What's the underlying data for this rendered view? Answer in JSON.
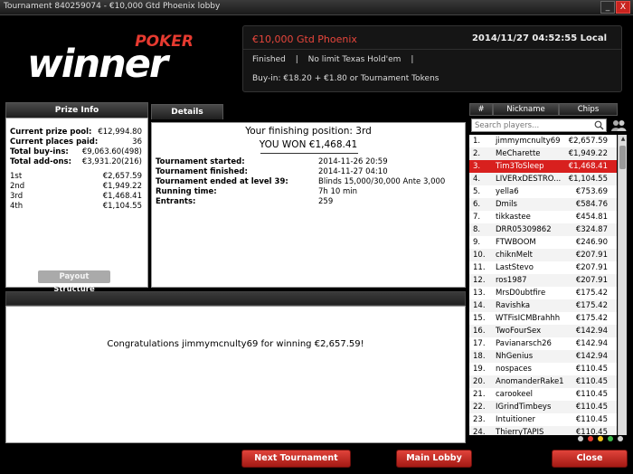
{
  "window": {
    "title": "Tournament 840259074 - €10,000 Gtd Phoenix lobby",
    "minimize_label": "_",
    "close_label": "X"
  },
  "logo": {
    "brand_top": "POKER",
    "brand_main": "winner"
  },
  "header": {
    "tournament_name": "€10,000 Gtd Phoenix",
    "datetime": "2014/11/27 04:52:55 Local",
    "status": "Finished",
    "game": "No limit Texas Hold'em",
    "buyin": "Buy-in: €18.20 + €1.80 or Tournament Tokens"
  },
  "tabs": {
    "prize_info": "Prize Info",
    "details": "Details"
  },
  "prize_info": {
    "current_prize_pool_label": "Current prize pool:",
    "current_prize_pool": "€12,994.80",
    "current_places_paid_label": "Current places paid:",
    "current_places_paid": "36",
    "total_buyins_label": "Total buy-ins:",
    "total_buyins": "€9,063.60(498)",
    "total_addons_label": "Total add-ons:",
    "total_addons": "€3,931.20(216)",
    "places": [
      {
        "place": "1st",
        "amount": "€2,657.59"
      },
      {
        "place": "2nd",
        "amount": "€1,949.22"
      },
      {
        "place": "3rd",
        "amount": "€1,468.41"
      },
      {
        "place": "4th",
        "amount": "€1,104.55"
      }
    ],
    "payout_button": "Payout Structure"
  },
  "details": {
    "finishing_position": "Your finishing position: 3rd",
    "you_won": "YOU WON €1,468.41",
    "rows": [
      {
        "label": "Tournament started:",
        "value": "2014-11-26 20:59"
      },
      {
        "label": "Tournament finished:",
        "value": "2014-11-27 04:10"
      },
      {
        "label": "Tournament ended at level 39:",
        "value": "Blinds 15,000/30,000 Ante 3,000"
      },
      {
        "label": "Running time:",
        "value": "7h 10 min"
      },
      {
        "label": "Entrants:",
        "value": "259"
      }
    ]
  },
  "message": {
    "text": "Congratulations jimmymcnulty69 for winning €2,657.59!"
  },
  "players": {
    "col_rank": "#",
    "col_nickname": "Nickname",
    "col_chips": "Chips",
    "search_placeholder": "Search players...",
    "highlight_index": 2,
    "rows": [
      {
        "rank": "1.",
        "name": "jimmymcnulty69",
        "chips": "€2,657.59"
      },
      {
        "rank": "2.",
        "name": "MeCharette",
        "chips": "€1,949.22"
      },
      {
        "rank": "3.",
        "name": "Tim3ToSleep",
        "chips": "€1,468.41"
      },
      {
        "rank": "4.",
        "name": "LIVERxDESTRO...",
        "chips": "€1,104.55"
      },
      {
        "rank": "5.",
        "name": "yella6",
        "chips": "€753.69"
      },
      {
        "rank": "6.",
        "name": "Dmils",
        "chips": "€584.76"
      },
      {
        "rank": "7.",
        "name": "tikkastee",
        "chips": "€454.81"
      },
      {
        "rank": "8.",
        "name": "DRR05309862",
        "chips": "€324.87"
      },
      {
        "rank": "9.",
        "name": "FTWBOOM",
        "chips": "€246.90"
      },
      {
        "rank": "10.",
        "name": "chiknMelt",
        "chips": "€207.91"
      },
      {
        "rank": "11.",
        "name": "LastStevo",
        "chips": "€207.91"
      },
      {
        "rank": "12.",
        "name": "ros1987",
        "chips": "€207.91"
      },
      {
        "rank": "13.",
        "name": "MrsD0ubtfire",
        "chips": "€175.42"
      },
      {
        "rank": "14.",
        "name": "Ravishka",
        "chips": "€175.42"
      },
      {
        "rank": "15.",
        "name": "WTFisICMBrahhh",
        "chips": "€175.42"
      },
      {
        "rank": "16.",
        "name": "TwoFourSex",
        "chips": "€142.94"
      },
      {
        "rank": "17.",
        "name": "Pavianarsch26",
        "chips": "€142.94"
      },
      {
        "rank": "18.",
        "name": "NhGenius",
        "chips": "€142.94"
      },
      {
        "rank": "19.",
        "name": "nospaces",
        "chips": "€110.45"
      },
      {
        "rank": "20.",
        "name": "AnomanderRake1",
        "chips": "€110.45"
      },
      {
        "rank": "21.",
        "name": "carookeel",
        "chips": "€110.45"
      },
      {
        "rank": "22.",
        "name": "IGrindTimbeys",
        "chips": "€110.45"
      },
      {
        "rank": "23.",
        "name": "Intuitioner",
        "chips": "€110.45"
      },
      {
        "rank": "24.",
        "name": "ThierryTAPIS",
        "chips": "€110.45"
      }
    ],
    "status_colors": [
      "#d0d0d0",
      "#e23b2f",
      "#f2c21b",
      "#3cb94a",
      "#d0d0d0"
    ]
  },
  "buttons": {
    "next_tournament": "Next Tournament",
    "main_lobby": "Main Lobby",
    "close": "Close"
  },
  "colors": {
    "accent": "#e8463c",
    "highlight_row": "#d8201e",
    "button": "#c9241f"
  }
}
